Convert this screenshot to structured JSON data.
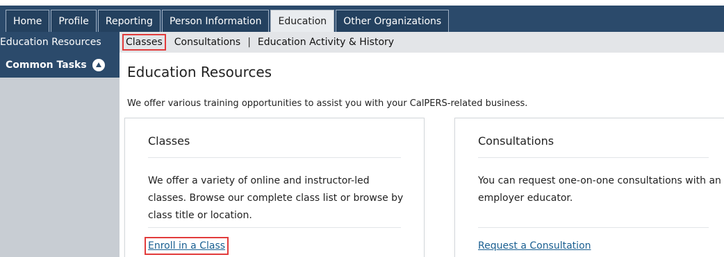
{
  "tabs": [
    {
      "label": "Home",
      "active": false
    },
    {
      "label": "Profile",
      "active": false
    },
    {
      "label": "Reporting",
      "active": false
    },
    {
      "label": "Person Information",
      "active": false
    },
    {
      "label": "Education",
      "active": true
    },
    {
      "label": "Other Organizations",
      "active": false
    }
  ],
  "subnav": {
    "section_label": "Education Resources",
    "links": [
      "Classes",
      "Consultations",
      "Education Activity & History"
    ],
    "separator": "|"
  },
  "sidebar": {
    "common_tasks_label": "Common Tasks",
    "common_tasks_icon": "collapse-arrow-icon"
  },
  "main": {
    "title": "Education Resources",
    "intro": "We offer various training opportunities to assist you with your CalPERS-related business."
  },
  "cards": {
    "classes": {
      "title": "Classes",
      "body": "We offer a variety of online and instructor-led classes. Browse our complete class list or browse by class title or location.",
      "link": "Enroll in a Class"
    },
    "consultations": {
      "title": "Consultations",
      "body": "You can request one-on-one consultations with an employer educator.",
      "link": "Request a Consultation"
    }
  },
  "colors": {
    "nav_navy": "#2b4a6b",
    "highlight_red": "#e23b3b",
    "link_blue": "#1a5f91"
  }
}
